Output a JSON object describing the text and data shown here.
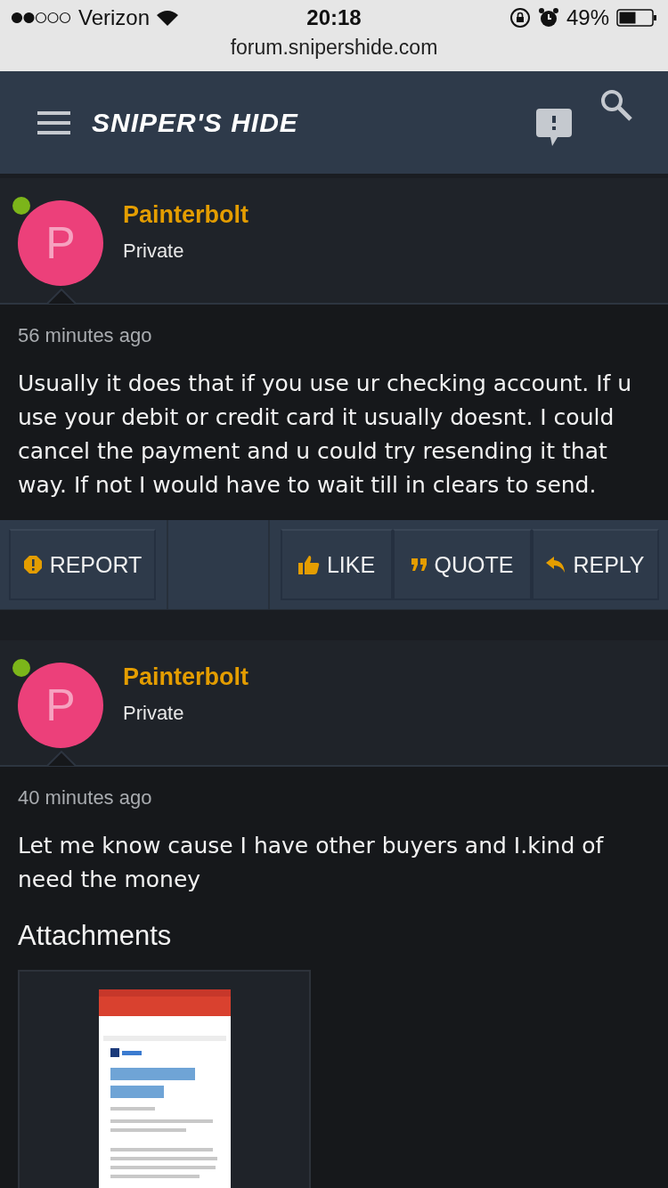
{
  "status_bar": {
    "carrier": "Verizon",
    "time": "20:18",
    "battery": "49%"
  },
  "url": "forum.snipershide.com",
  "header": {
    "logo": "SNIPER'S HIDE"
  },
  "posts": [
    {
      "author": "Painterbolt",
      "avatar_letter": "P",
      "online": true,
      "role": "Private",
      "time": "56 minutes ago",
      "message": "Usually it does that if you use ur checking account. If u use your debit or credit card it usually doesnt. I could cancel the payment and u could try resending it that way. If not I would have to wait till in clears to send.",
      "actions": [
        {
          "kind": "report",
          "label": "REPORT"
        },
        {
          "kind": "like",
          "label": "LIKE"
        },
        {
          "kind": "quote",
          "label": "QUOTE"
        },
        {
          "kind": "reply",
          "label": "REPLY"
        }
      ]
    },
    {
      "author": "Painterbolt",
      "avatar_letter": "P",
      "online": true,
      "role": "Private",
      "time": "40 minutes ago",
      "message": "Let me know cause I have other buyers and I.kind of need the money",
      "attachments_heading": "Attachments"
    }
  ]
}
